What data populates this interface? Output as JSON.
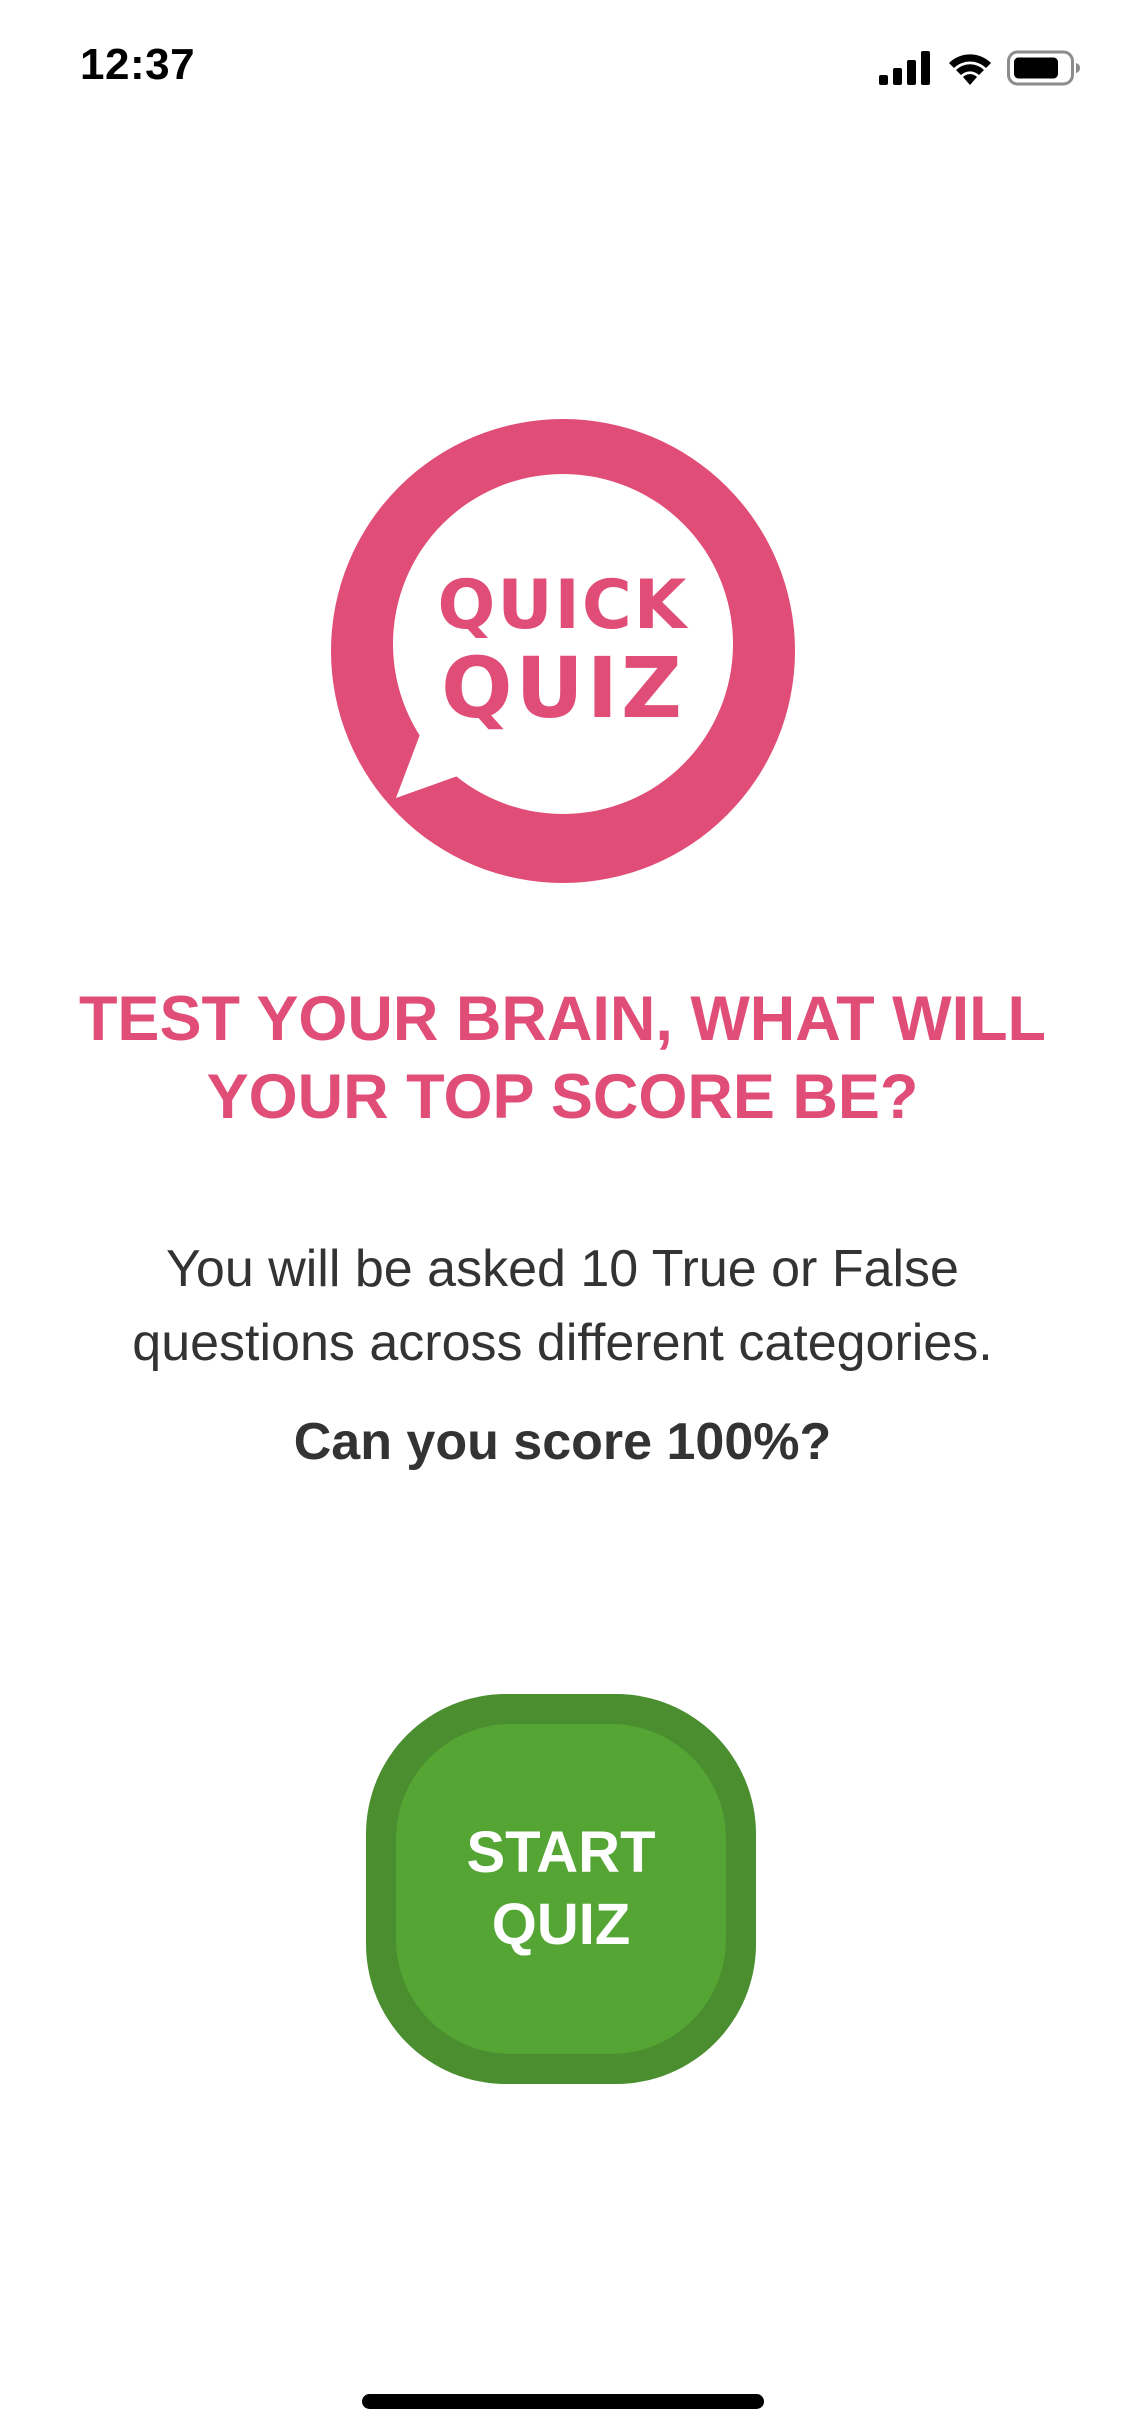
{
  "status_bar": {
    "time": "12:37",
    "icons": [
      "cellular-signal-icon",
      "wifi-icon",
      "battery-icon"
    ]
  },
  "logo": {
    "line1": "QUICK",
    "line2": "QUIZ",
    "color": "#e04e78"
  },
  "intro": {
    "headline": "TEST YOUR BRAIN, WHAT WILL YOUR TOP SCORE BE?",
    "description": "You will be asked 10 True or False questions across different categories.",
    "challenge": "Can you score 100%?"
  },
  "start_button": {
    "label": "START QUIZ",
    "color": "#55a535",
    "border_color": "#4a8e30"
  },
  "colors": {
    "accent": "#e04e78",
    "text": "#333333",
    "background": "#ffffff"
  }
}
